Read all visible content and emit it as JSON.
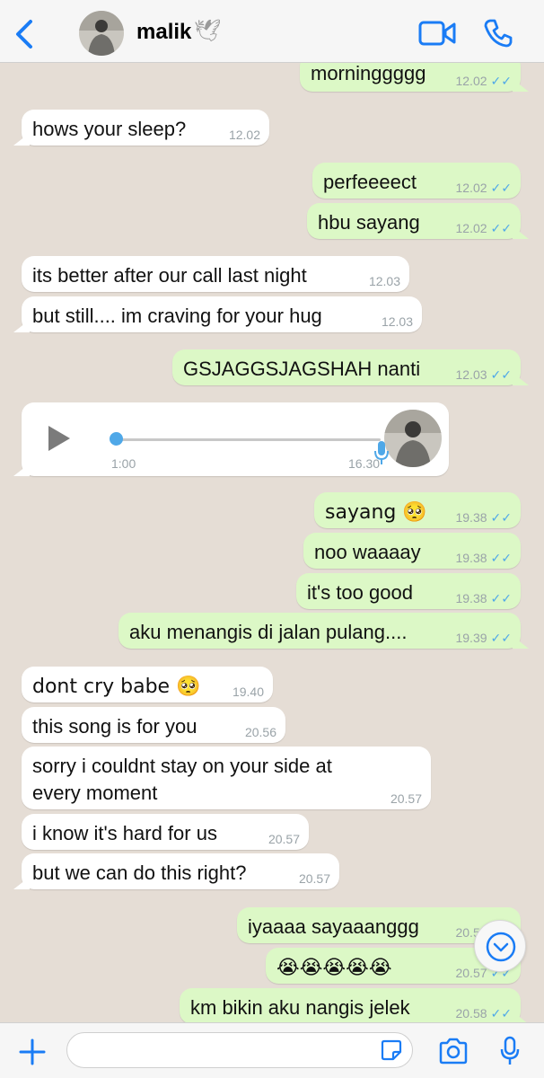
{
  "header": {
    "contact_name": "malik",
    "contact_emoji": "🕊"
  },
  "messages": [
    {
      "dir": "out",
      "text": "morninggggg",
      "time": "12.02",
      "read": true
    },
    {
      "dir": "in",
      "text": "hows your sleep?",
      "time": "12.02"
    },
    {
      "dir": "out",
      "text": "perfeeeect",
      "time": "12.02",
      "read": true
    },
    {
      "dir": "out",
      "text": "hbu sayang",
      "time": "12.02",
      "read": true
    },
    {
      "dir": "in",
      "text": "its better after our call last night",
      "time": "12.03"
    },
    {
      "dir": "in",
      "text": "but still.... im craving for your hug",
      "time": "12.03"
    },
    {
      "dir": "out",
      "text": "GSJAGGSJAGSHAH nanti",
      "time": "12.03",
      "read": true
    },
    {
      "dir": "out",
      "text": "sayang 🥺",
      "time": "19.38",
      "read": true
    },
    {
      "dir": "out",
      "text": "noo waaaay",
      "time": "19.38",
      "read": true
    },
    {
      "dir": "out",
      "text": "it's too good",
      "time": "19.38",
      "read": true
    },
    {
      "dir": "out",
      "text": "aku menangis di jalan pulang....",
      "time": "19.39",
      "read": true
    },
    {
      "dir": "in",
      "text": "dont cry babe 🥺",
      "time": "19.40"
    },
    {
      "dir": "in",
      "text": "this song is for you",
      "time": "20.56"
    },
    {
      "dir": "in",
      "text": "sorry i couldnt stay on your side at every moment",
      "time": "20.57"
    },
    {
      "dir": "in",
      "text": "i know it's hard for us",
      "time": "20.57"
    },
    {
      "dir": "in",
      "text": "but we can do this right?",
      "time": "20.57"
    },
    {
      "dir": "out",
      "text": "iyaaaa sayaaanggg",
      "time": "20.58",
      "read": true
    },
    {
      "dir": "out",
      "text": "😭😭😭😭😭",
      "time": "20.57",
      "read": true
    },
    {
      "dir": "out",
      "text": "km bikin aku nangis jelek",
      "time": "20.58",
      "read": true
    }
  ],
  "voice_note": {
    "duration": "1:00",
    "time": "16.30"
  },
  "footer": {
    "input_placeholder": ""
  },
  "colors": {
    "accent": "#1a7cf5",
    "incoming_bubble": "#ffffff",
    "outgoing_bubble": "#dcf8c6",
    "read_ticks": "#4fa8e8",
    "chat_background": "#e5ddd5"
  }
}
